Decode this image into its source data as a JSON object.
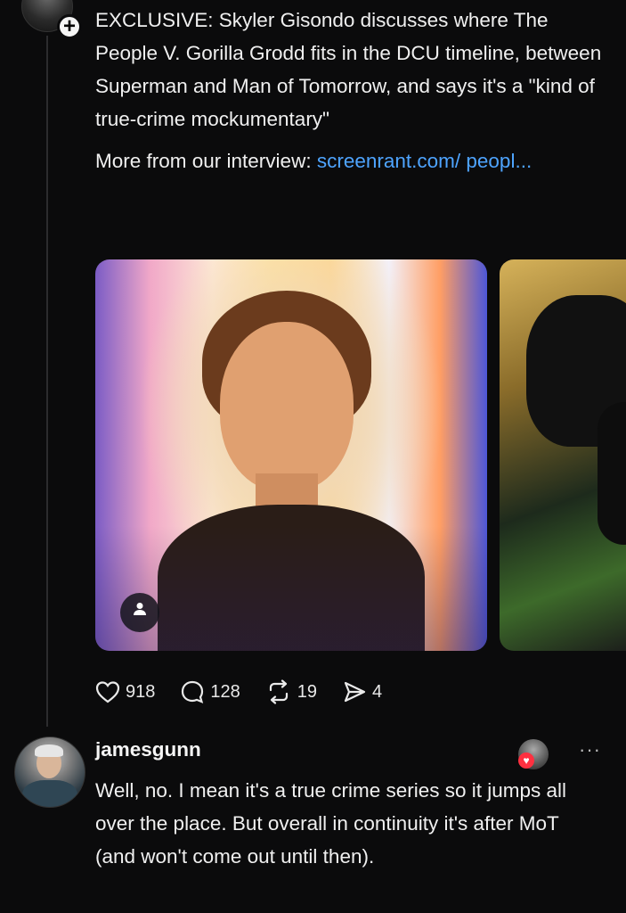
{
  "post": {
    "text": "EXCLUSIVE: Skyler Gisondo discusses where The People V. Gorilla Grodd fits in the DCU timeline, between Superman and Man of Tomorrow, and says it's a \"kind of true-crime mockumentary\"",
    "more_prefix": "More from our interview: ",
    "more_link": "screenrant.com/ peopl...",
    "plus_glyph": "+",
    "media": {
      "user_tag_icon": "person-icon"
    }
  },
  "actions": {
    "likes": "918",
    "comments": "128",
    "reposts": "19",
    "shares": "4"
  },
  "reply": {
    "username": "jamesgunn",
    "text": "Well, no. I mean it's a true crime series so it jumps all over the place. But overall in continuity it's after MoT (and won't come out until then).",
    "more_glyph": "···"
  }
}
